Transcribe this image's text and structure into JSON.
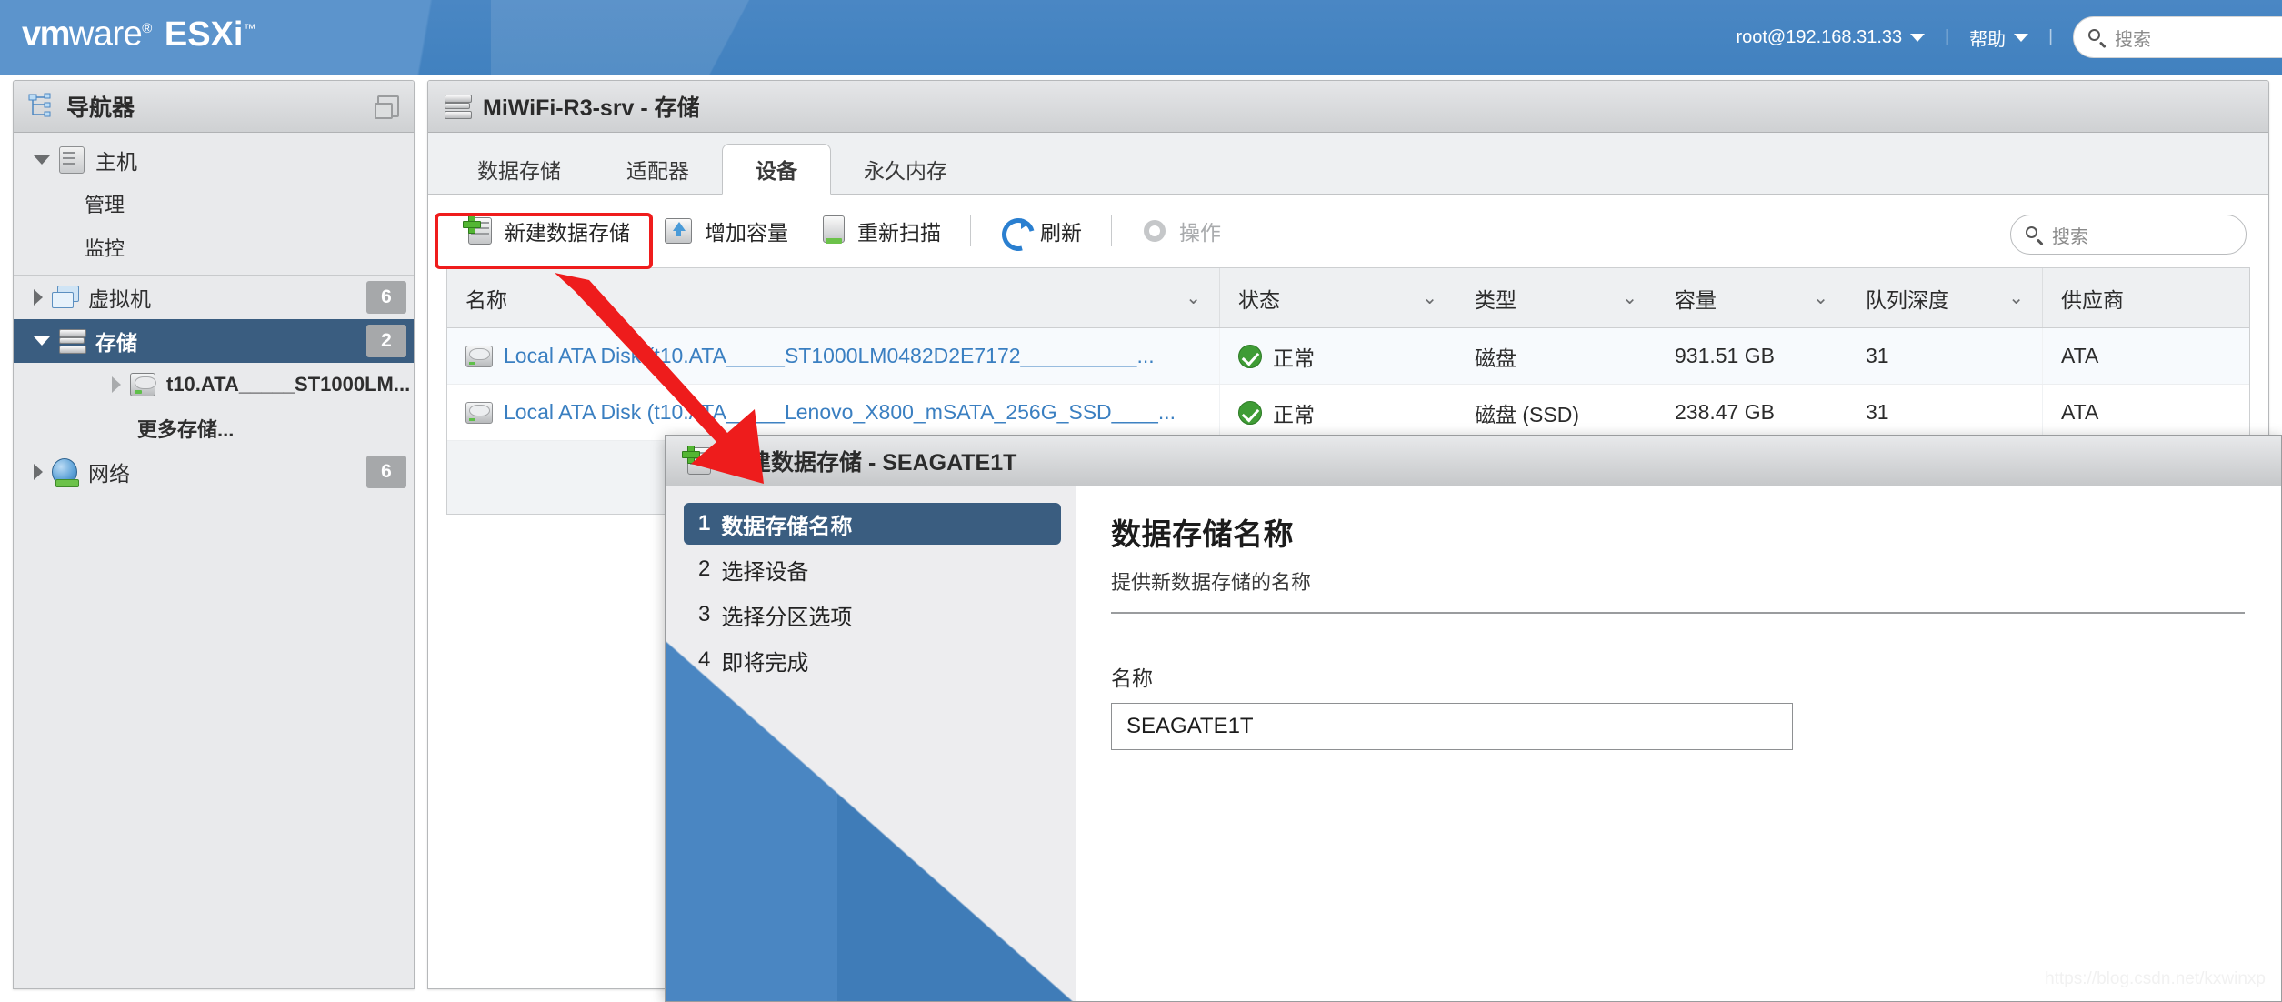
{
  "header": {
    "brand_vm": "vm",
    "brand_ware": "ware",
    "brand_reg": "®",
    "brand_product": "ESXi",
    "brand_tm": "™",
    "user": "root@192.168.31.33",
    "help": "帮助",
    "search_placeholder": "搜索",
    "accent_blue": "#4181bf"
  },
  "navigator": {
    "title": "导航器",
    "items": [
      {
        "label": "主机",
        "icon": "host-icon",
        "indent": 0,
        "expanded": true,
        "badge": ""
      },
      {
        "label": "管理",
        "icon": "",
        "indent": 1,
        "badge": ""
      },
      {
        "label": "监控",
        "icon": "",
        "indent": 1,
        "badge": ""
      },
      {
        "label": "虚拟机",
        "icon": "vm-icon",
        "indent": 0,
        "expanded": false,
        "badge": "6"
      },
      {
        "label": "存储",
        "icon": "storage-icon",
        "indent": 0,
        "expanded": true,
        "badge": "2",
        "selected": true
      },
      {
        "label": "t10.ATA_____ST1000LM...",
        "icon": "disk-icon",
        "indent": 2,
        "badge": ""
      },
      {
        "label": "更多存储...",
        "icon": "",
        "indent": 3,
        "badge": ""
      },
      {
        "label": "网络",
        "icon": "network-icon",
        "indent": 0,
        "expanded": false,
        "badge": "6"
      }
    ]
  },
  "main": {
    "title": "MiWiFi-R3-srv - 存储",
    "tabs": [
      {
        "label": "数据存储",
        "active": false
      },
      {
        "label": "适配器",
        "active": false
      },
      {
        "label": "设备",
        "active": true
      },
      {
        "label": "永久内存",
        "active": false
      }
    ],
    "toolbar": {
      "new_datastore": "新建数据存储",
      "increase_capacity": "增加容量",
      "rescan": "重新扫描",
      "refresh": "刷新",
      "actions": "操作",
      "search_placeholder": "搜索",
      "highlight_color": "#ef1c1c"
    },
    "table": {
      "columns": [
        "名称",
        "状态",
        "类型",
        "容量",
        "队列深度",
        "供应商"
      ],
      "rows": [
        {
          "name": "Local ATA Disk (t10.ATA_____ST1000LM0482D2E7172__________...",
          "status": "正常",
          "type": "磁盘",
          "capacity": "931.51 GB",
          "queue_depth": "31",
          "vendor": "ATA"
        },
        {
          "name": "Local ATA Disk (t10.ATA_____Lenovo_X800_mSATA_256G_SSD____...",
          "status": "正常",
          "type": "磁盘 (SSD)",
          "capacity": "238.47 GB",
          "queue_depth": "31",
          "vendor": "ATA"
        }
      ]
    }
  },
  "dialog": {
    "title": "新建数据存储 - SEAGATE1T",
    "steps": [
      {
        "num": "1",
        "label": "数据存储名称",
        "active": true
      },
      {
        "num": "2",
        "label": "选择设备",
        "active": false
      },
      {
        "num": "3",
        "label": "选择分区选项",
        "active": false
      },
      {
        "num": "4",
        "label": "即将完成",
        "active": false
      }
    ],
    "heading": "数据存储名称",
    "subtitle": "提供新数据存储的名称",
    "field_label": "名称",
    "field_value": "SEAGATE1T"
  },
  "watermark": "https://blog.csdn.net/kxwinxp"
}
